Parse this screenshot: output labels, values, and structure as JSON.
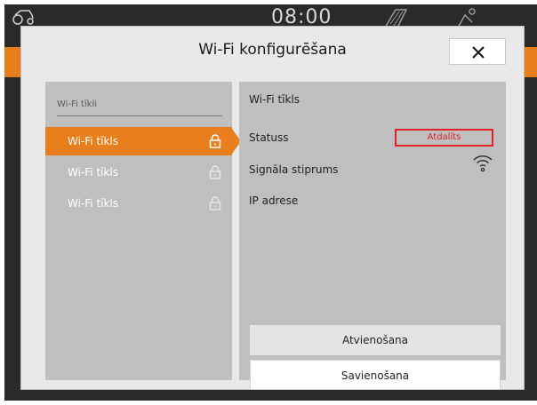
{
  "topbar": {
    "time": "08:00"
  },
  "dialog": {
    "title": "Wi-Fi konfigurēšana",
    "close_label": "×"
  },
  "networks": {
    "header": "Wi-Fi tīkli",
    "items": [
      {
        "label": "Wi-Fi tīkls",
        "selected": true
      },
      {
        "label": "Wi-Fi tīkls",
        "selected": false
      },
      {
        "label": "Wi-Fi tīkls",
        "selected": false
      }
    ]
  },
  "details": {
    "title": "Wi-Fi tīkls",
    "status_label": "Statuss",
    "status_value": "Atdalīts",
    "signal_label": "Signāla stiprums",
    "ip_label": "IP adrese"
  },
  "buttons": {
    "disconnect": "Atvienošana",
    "connect": "Savienošana"
  },
  "colors": {
    "accent": "#e87e1c",
    "status": "#e0212a",
    "panel": "#bfbfbf"
  }
}
